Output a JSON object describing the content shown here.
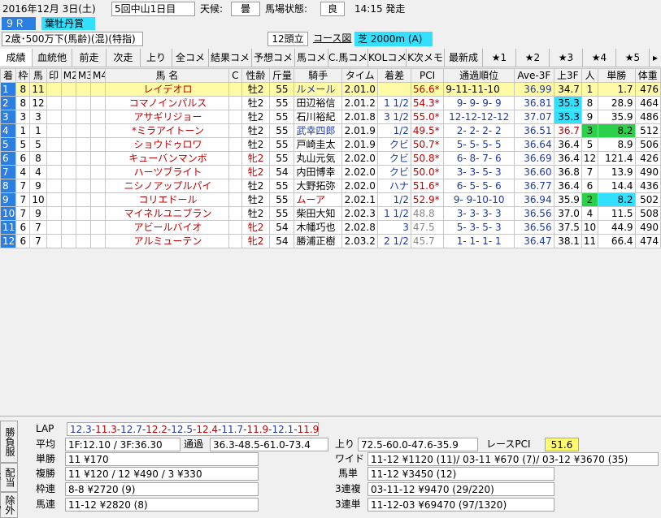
{
  "header": {
    "date": "2016年12月  3日(土)",
    "meeting": "5回中山1日目",
    "weather_label": "天候:",
    "weather": "曇",
    "track_label": "馬場状態:",
    "track": "良",
    "post_time": "14:15 発走",
    "race_no": "９Ｒ",
    "race_name": "葉牡丹賞",
    "conditions": "2歳･500万下(馬齢)(混)(特指)",
    "field_size": "12頭立",
    "course_label": "コース図",
    "course": "芝  2000m (A)"
  },
  "tabs": [
    "成績",
    "血統他",
    "前走",
    "次走",
    "上り",
    "全コメ",
    "結果コメ",
    "予想コメ",
    "馬コメ",
    "C.馬コメ",
    "KOLコメ",
    "K次メモ",
    "最新成",
    "★1",
    "★2",
    "★3",
    "★4",
    "★5"
  ],
  "table": {
    "headers": [
      "着",
      "枠",
      "馬",
      "印",
      "M2",
      "M3",
      "M4",
      "馬 名",
      "C",
      "性齢",
      "斤量",
      "騎手",
      "タイム",
      "着差",
      "PCI",
      "通過順位",
      "Ave-3F",
      "上3F",
      "人",
      "単勝",
      "体重"
    ],
    "rows": [
      [
        "1",
        "8",
        "11",
        "",
        "",
        "",
        "",
        "レイデオロ",
        "",
        "牡2",
        "55",
        "ルメール",
        "2.01.0",
        "",
        "56.6*",
        "9-11-11-10",
        "36.99",
        "34.7",
        "1",
        "1.7",
        "476"
      ],
      [
        "2",
        "8",
        "12",
        "",
        "",
        "",
        "",
        "コマノインパルス",
        "",
        "牡2",
        "55",
        "田辺裕信",
        "2.01.2",
        "1 1/2",
        "54.3*",
        "9- 9- 9- 9",
        "36.81",
        "35.3",
        "8",
        "28.9",
        "464"
      ],
      [
        "3",
        "3",
        "3",
        "",
        "",
        "",
        "",
        "アサギリジョー",
        "",
        "牡2",
        "55",
        "石川裕紀",
        "2.01.8",
        "3 1/2",
        "55.0*",
        "12-12-12-12",
        "37.07",
        "35.3",
        "9",
        "35.9",
        "486"
      ],
      [
        "4",
        "1",
        "1",
        "",
        "",
        "",
        "",
        "*ミラアイトーン",
        "",
        "牡2",
        "55",
        "武幸四郎",
        "2.01.9",
        "1/2",
        "49.5*",
        "2- 2- 2- 2",
        "36.51",
        "36.7",
        "3",
        "8.2",
        "512"
      ],
      [
        "5",
        "5",
        "5",
        "",
        "",
        "",
        "",
        "ショウドゥロワ",
        "",
        "牡2",
        "55",
        "戸崎圭太",
        "2.01.9",
        "クビ",
        "50.7*",
        "5- 5- 5- 5",
        "36.64",
        "36.4",
        "5",
        "8.9",
        "506"
      ],
      [
        "6",
        "6",
        "8",
        "",
        "",
        "",
        "",
        "キューバンマンボ",
        "",
        "牝2",
        "55",
        "丸山元気",
        "2.02.0",
        "クビ",
        "50.8*",
        "6- 8- 7- 6",
        "36.69",
        "36.4",
        "12",
        "121.4",
        "426"
      ],
      [
        "7",
        "4",
        "4",
        "",
        "",
        "",
        "",
        "ハーツブライト",
        "",
        "牝2",
        "54",
        "内田博幸",
        "2.02.0",
        "クビ",
        "50.0*",
        "3- 3- 5- 3",
        "36.60",
        "36.8",
        "7",
        "13.9",
        "490"
      ],
      [
        "8",
        "7",
        "9",
        "",
        "",
        "",
        "",
        "ニシノアップルパイ",
        "",
        "牡2",
        "55",
        "大野拓弥",
        "2.02.0",
        "ハナ",
        "51.6*",
        "6- 5- 5- 6",
        "36.77",
        "36.4",
        "6",
        "14.4",
        "436"
      ],
      [
        "9",
        "7",
        "10",
        "",
        "",
        "",
        "",
        "コリエドール",
        "",
        "牡2",
        "55",
        "ムーア",
        "2.02.1",
        "1/2",
        "52.9*",
        "9- 9-10-10",
        "36.94",
        "35.9",
        "2",
        "8.2",
        "502"
      ],
      [
        "10",
        "7",
        "9",
        "",
        "",
        "",
        "",
        "マイネルユニブラン",
        "",
        "牡2",
        "55",
        "柴田大知",
        "2.02.3",
        "1 1/2",
        "48.8",
        "3- 3- 3- 3",
        "36.56",
        "37.0",
        "4",
        "11.5",
        "508"
      ],
      [
        "11",
        "6",
        "7",
        "",
        "",
        "",
        "",
        "アビールバイオ",
        "",
        "牝2",
        "54",
        "木幡巧也",
        "2.02.8",
        "3",
        "47.5",
        "5- 3- 5- 3",
        "36.56",
        "37.5",
        "10",
        "44.9",
        "490"
      ],
      [
        "12",
        "6",
        "7",
        "",
        "",
        "",
        "",
        "アルミューテン",
        "",
        "牝2",
        "54",
        "勝浦正樹",
        "2.03.2",
        "2 1/2",
        "45.7",
        "1- 1- 1- 1",
        "36.47",
        "38.1",
        "11",
        "66.4",
        "474"
      ]
    ]
  },
  "side_tabs": [
    "勝負服",
    "配当等",
    "除外馬"
  ],
  "bottom": {
    "lap_label": "LAP",
    "lap": "12.3-11.3-12.7-12.2-12.5-12.4-11.7-11.9-12.1-11.9",
    "avg_label": "平均",
    "avg": "1F:12.10 / 3F:36.30",
    "pass_label": "通過",
    "pass": "36.3-48.5-61.0-73.4",
    "agari_label": "上り",
    "agari": "72.5-60.0-47.6-35.9",
    "race_pci_label": "レースPCI",
    "race_pci": "51.6",
    "tansho_label": "単勝",
    "tansho": "11 ¥170",
    "fukusho_label": "複勝",
    "fukusho": "11 ¥120 / 12 ¥490 / 3 ¥330",
    "wakuren_label": "枠連",
    "wakuren": "8-8 ¥2720 (9)",
    "umaren_label": "馬連",
    "umaren": "11-12 ¥2820 (8)",
    "wide_label": "ワイド",
    "wide": "11-12 ¥1120 (11)/ 03-11 ¥670 (7)/ 03-12 ¥3670 (35)",
    "umatan_label": "馬単",
    "umatan": "11-12 ¥3450 (12)",
    "sanrenpuku_label": "3連複",
    "sanrenpuku": "03-11-12 ¥9470 (29/220)",
    "sanrentan_label": "3連単",
    "sanrentan": "11-12-03 ¥69470 (97/1320)"
  }
}
